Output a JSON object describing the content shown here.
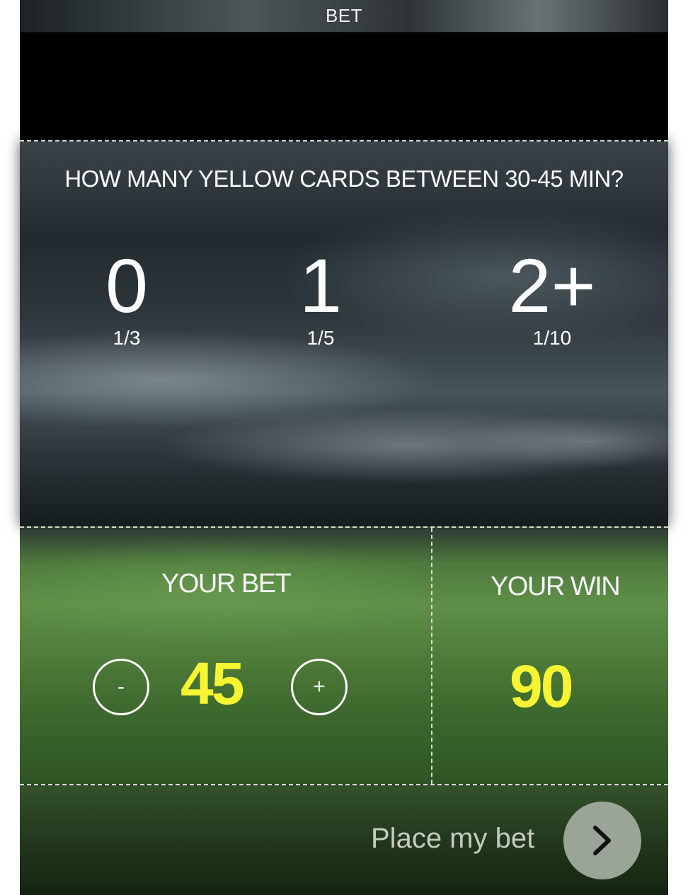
{
  "header": {
    "title": "BET"
  },
  "question": {
    "text": "HOW MANY YELLOW CARDS BETWEEN 30-45 MIN?"
  },
  "options": [
    {
      "value": "0",
      "odds": "1/3"
    },
    {
      "value": "1",
      "odds": "1/5"
    },
    {
      "value": "2+",
      "odds": "1/10"
    }
  ],
  "bet": {
    "label": "YOUR BET",
    "decrement": "-",
    "amount": "45",
    "increment": "+"
  },
  "win": {
    "label": "YOUR WIN",
    "amount": "90"
  },
  "footer": {
    "place_label": "Place my bet",
    "arrow_icon": "chevron-right-icon"
  },
  "colors": {
    "accent_yellow": "#f7f532",
    "dashed_border": "#d6dad6"
  }
}
